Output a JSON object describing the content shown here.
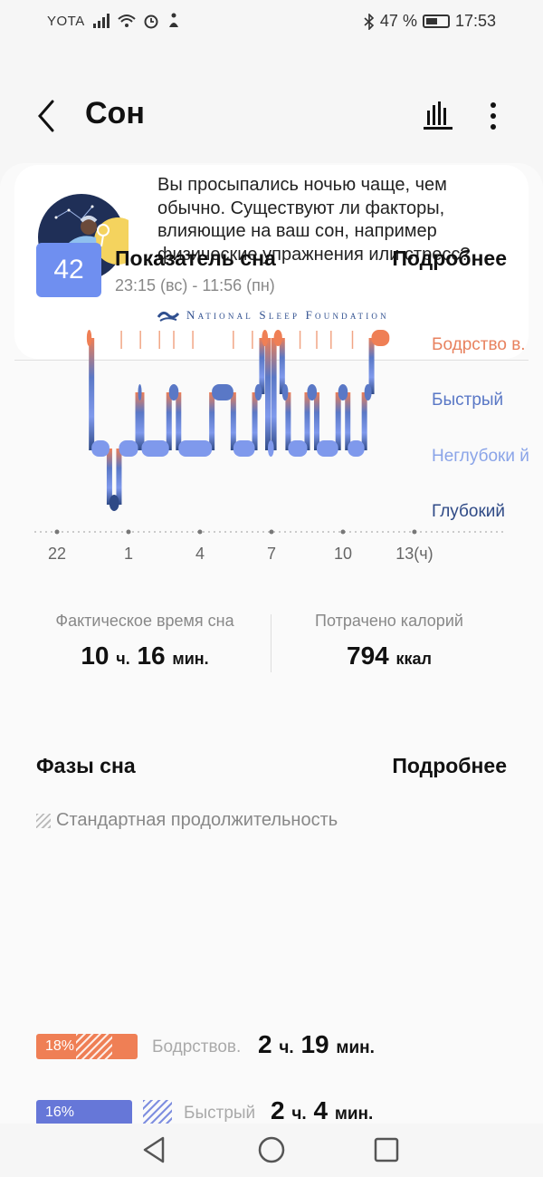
{
  "status_bar": {
    "carrier": "YOTA",
    "battery_percent": "47 %",
    "time": "17:53",
    "icons": [
      "signal-icon",
      "wifi-icon",
      "alarm-icon",
      "accessibility-icon",
      "bluetooth-icon",
      "battery-icon"
    ]
  },
  "appbar": {
    "title": "Сон",
    "back_icon": "back-arrow-icon",
    "stats_icon": "bar-chart-icon",
    "more_icon": "more-vertical-icon"
  },
  "tip": {
    "text": "Вы просыпались ночью чаще, чем обычно. Существуют ли факторы, влияющие на ваш сон, например физические упражнения или стресс?",
    "source": "National Sleep Foundation"
  },
  "score": {
    "value": "42",
    "title": "Показатель сна",
    "period": "23:15 (вс) - 11:56 (пн)",
    "more": "Подробнее"
  },
  "chart_data": {
    "type": "line",
    "title": "",
    "x_ticks": [
      "22",
      "1",
      "4",
      "7",
      "10",
      "13(ч)"
    ],
    "x_tick_hours": [
      22,
      25,
      28,
      31,
      34,
      37
    ],
    "stages": [
      "Бодрство в.",
      "Быстрый",
      "Неглубоки й",
      "Глубокий"
    ],
    "stage_labels": {
      "awake": "Бодрство в.",
      "rem": "Быстрый",
      "light": "Неглубоки й",
      "deep": "Глубокий"
    },
    "colors": {
      "awake": "#ef7f55",
      "rem": "#5a78c6",
      "light": "#7f99ec",
      "deep": "#2f4a86"
    },
    "segments": [
      [
        "awake",
        23.25,
        23.45
      ],
      [
        "light",
        23.45,
        24.2
      ],
      [
        "deep",
        24.2,
        24.6
      ],
      [
        "light",
        24.6,
        25.4
      ],
      [
        "rem",
        25.4,
        25.55
      ],
      [
        "light",
        25.55,
        26.7
      ],
      [
        "rem",
        26.7,
        27.1
      ],
      [
        "light",
        27.1,
        28.5
      ],
      [
        "rem",
        28.5,
        29.4
      ],
      [
        "light",
        29.4,
        30.3
      ],
      [
        "rem",
        30.3,
        30.6
      ],
      [
        "awake",
        30.6,
        30.85
      ],
      [
        "light",
        30.85,
        31.1
      ],
      [
        "awake",
        31.1,
        31.45
      ],
      [
        "rem",
        31.45,
        31.7
      ],
      [
        "light",
        31.7,
        32.5
      ],
      [
        "rem",
        32.5,
        32.9
      ],
      [
        "light",
        32.9,
        33.8
      ],
      [
        "rem",
        33.8,
        34.2
      ],
      [
        "light",
        34.2,
        34.9
      ],
      [
        "rem",
        34.9,
        35.2
      ],
      [
        "awake",
        35.2,
        35.95
      ]
    ],
    "awake_ticks": [
      24.7,
      25.5,
      26.3,
      26.9,
      27.7,
      29.4,
      30.2,
      32.2,
      32.9,
      33.5,
      34.4
    ]
  },
  "stats": {
    "sleep_time_label": "Фактическое время сна",
    "sleep_h": "10",
    "sleep_h_unit": "ч.",
    "sleep_m": "16",
    "sleep_m_unit": "мин.",
    "calories_label": "Потрачено калорий",
    "calories": "794",
    "calories_unit": "ккал"
  },
  "phases": {
    "title": "Фазы сна",
    "more": "Подробнее",
    "standard": "Стандартная продолжительность",
    "rows": [
      {
        "percent": "18%",
        "name": "Бодрствов.",
        "h": "2",
        "h_unit": "ч.",
        "m": "19",
        "m_unit": "мин.",
        "color": "#ef7f55",
        "fraction": 0.18
      },
      {
        "percent": "16%",
        "name": "Быстрый",
        "h": "2",
        "h_unit": "ч.",
        "m": "4",
        "m_unit": "мин.",
        "color": "#6677d8",
        "fraction": 0.16
      }
    ]
  },
  "navbar": {
    "icons": [
      "nav-back-icon",
      "nav-home-icon",
      "nav-recents-icon"
    ]
  }
}
